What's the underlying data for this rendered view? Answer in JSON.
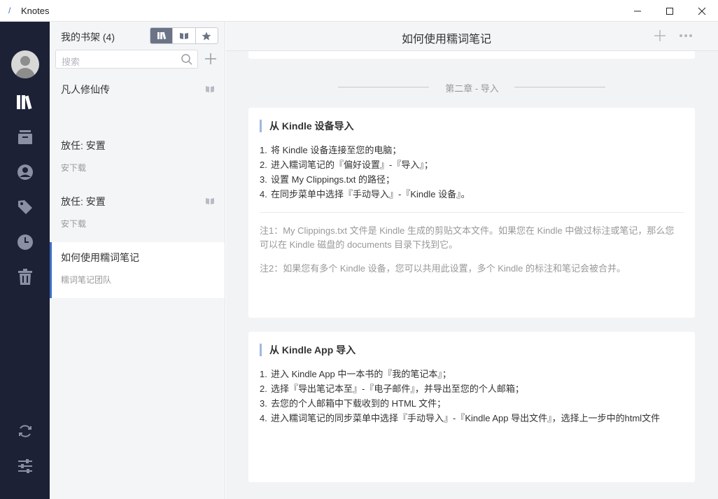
{
  "window": {
    "app_title": "Knotes"
  },
  "sidebar": {
    "items": [
      {
        "name": "library",
        "icon": "library-icon"
      },
      {
        "name": "archive",
        "icon": "archive-icon"
      },
      {
        "name": "profile",
        "icon": "user-circle-icon"
      },
      {
        "name": "tags",
        "icon": "tag-icon"
      },
      {
        "name": "history",
        "icon": "clock-icon"
      },
      {
        "name": "trash",
        "icon": "trash-icon"
      }
    ],
    "bottom": [
      {
        "name": "sync",
        "icon": "sync-icon"
      },
      {
        "name": "settings",
        "icon": "sliders-icon"
      }
    ]
  },
  "shelf": {
    "title": "我的书架 (4)",
    "search_placeholder": "搜索",
    "books": [
      {
        "name": "凡人修仙传",
        "author": ""
      },
      {
        "name": "放任: 安置",
        "author": "安下载"
      },
      {
        "name": "放任: 安置",
        "author": "安下载"
      },
      {
        "name": "如何使用糯词笔记",
        "author": "糯词笔记团队"
      }
    ]
  },
  "document": {
    "title": "如何使用糯词笔记",
    "chapter": "第二章 - 导入",
    "sections": [
      {
        "heading": "从 Kindle 设备导入",
        "steps": [
          "将 Kindle 设备连接至您的电脑；",
          "进入糯词笔记的『偏好设置』-『导入』；",
          "设置 My Clippings.txt 的路径；",
          "在同步菜单中选择『手动导入』-『Kindle 设备』。"
        ],
        "notes": [
          "注1：My Clippings.txt 文件是 Kindle 生成的剪贴文本文件。如果您在 Kindle 中做过标注或笔记，那么您可以在 Kindle 磁盘的 documents 目录下找到它。",
          "注2：如果您有多个 Kindle 设备，您可以共用此设置，多个 Kindle 的标注和笔记会被合并。"
        ]
      },
      {
        "heading": "从 Kindle App 导入",
        "steps": [
          "进入 Kindle App 中一本书的『我的笔记本』；",
          "选择『导出笔记本至』-『电子邮件』，并导出至您的个人邮箱；",
          "去您的个人邮箱中下载收到的 HTML 文件；",
          "进入糯词笔记的同步菜单中选择『手动导入』-『Kindle App 导出文件』，选择上一步中的html文件"
        ]
      }
    ]
  },
  "colors": {
    "rail": "#1d2136",
    "accent": "#3b6fc7",
    "heading_bar": "#9fb8de"
  }
}
